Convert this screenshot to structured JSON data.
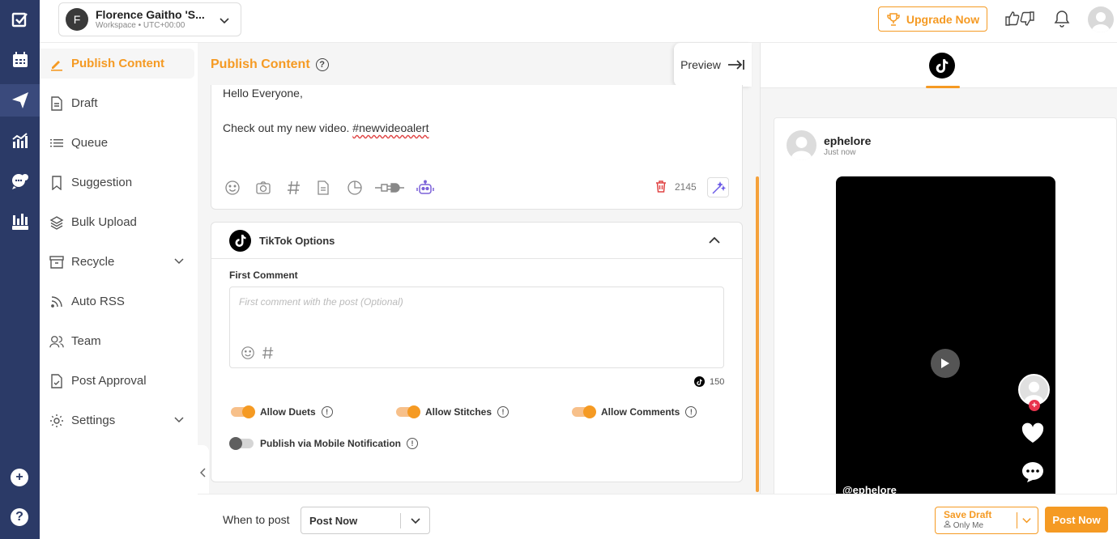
{
  "workspace": {
    "initial": "F",
    "name": "Florence Gaitho 'S...",
    "sub": "Workspace • UTC+00:00"
  },
  "header": {
    "upgrade_label": "Upgrade Now"
  },
  "sidebar": {
    "items": [
      {
        "label": "Publish Content",
        "icon": "pencil-icon"
      },
      {
        "label": "Draft",
        "icon": "document-icon"
      },
      {
        "label": "Queue",
        "icon": "list-icon"
      },
      {
        "label": "Suggestion",
        "icon": "bookmark-icon"
      },
      {
        "label": "Bulk Upload",
        "icon": "layers-icon"
      },
      {
        "label": "Recycle",
        "icon": "archive-icon"
      },
      {
        "label": "Auto RSS",
        "icon": "rss-icon"
      },
      {
        "label": "Team",
        "icon": "users-icon"
      },
      {
        "label": "Post Approval",
        "icon": "approval-icon"
      },
      {
        "label": "Settings",
        "icon": "gear-icon"
      }
    ]
  },
  "main": {
    "title": "Publish Content",
    "preview_label": "Preview",
    "editor": {
      "line1": "Hello Everyone,",
      "line2_prefix": "Check out my new video. ",
      "line2_hashtag": "#newvideoalert",
      "char_count": "2145"
    },
    "tiktok": {
      "title": "TikTok Options",
      "first_comment_label": "First Comment",
      "first_comment_placeholder": "First comment with the post (Optional)",
      "comment_count": "150",
      "allow_duets": "Allow Duets",
      "allow_stitches": "Allow Stitches",
      "allow_comments": "Allow Comments",
      "mobile_notification": "Publish via Mobile Notification"
    }
  },
  "bottom": {
    "when_label": "When to post",
    "when_value": "Post Now",
    "save_draft": "Save Draft",
    "visibility": "Only Me",
    "post_now": "Post Now"
  },
  "preview": {
    "username": "ephelore",
    "time": "Just now",
    "video_user": "@ephelore"
  },
  "colors": {
    "accent": "#f59a23",
    "rail": "#2b3a67"
  }
}
